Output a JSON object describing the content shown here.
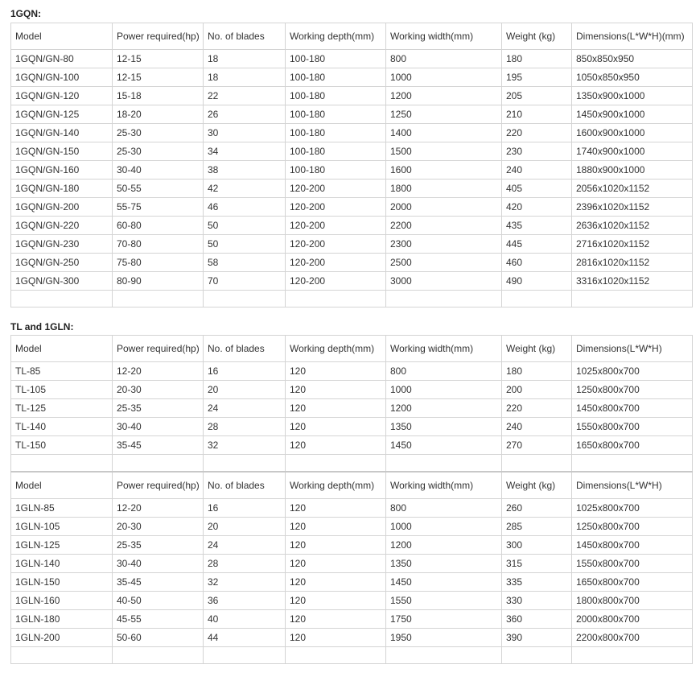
{
  "columns": [
    "Model",
    "Power required(hp)",
    "No. of blades",
    "Working depth(mm)",
    "Working width(mm)",
    "Weight (kg)"
  ],
  "section1": {
    "title": "1GQN:",
    "dim_header": "Dimensions(L*W*H)(mm)",
    "rows": [
      [
        "1GQN/GN-80",
        "12-15",
        "18",
        "100-180",
        "800",
        "180",
        "850x850x950"
      ],
      [
        "1GQN/GN-100",
        "12-15",
        "18",
        "100-180",
        "1000",
        "195",
        "1050x850x950"
      ],
      [
        "1GQN/GN-120",
        "15-18",
        "22",
        "100-180",
        "1200",
        "205",
        "1350x900x1000"
      ],
      [
        "1GQN/GN-125",
        "18-20",
        "26",
        "100-180",
        "1250",
        "210",
        "1450x900x1000"
      ],
      [
        "1GQN/GN-140",
        "25-30",
        "30",
        "100-180",
        "1400",
        "220",
        "1600x900x1000"
      ],
      [
        "1GQN/GN-150",
        "25-30",
        "34",
        "100-180",
        "1500",
        "230",
        "1740x900x1000"
      ],
      [
        "1GQN/GN-160",
        "30-40",
        "38",
        "100-180",
        "1600",
        "240",
        "1880x900x1000"
      ],
      [
        "1GQN/GN-180",
        "50-55",
        "42",
        "120-200",
        "1800",
        "405",
        "2056x1020x1152"
      ],
      [
        "1GQN/GN-200",
        "55-75",
        "46",
        "120-200",
        "2000",
        "420",
        "2396x1020x1152"
      ],
      [
        "1GQN/GN-220",
        "60-80",
        "50",
        "120-200",
        "2200",
        "435",
        "2636x1020x1152"
      ],
      [
        "1GQN/GN-230",
        "70-80",
        "50",
        "120-200",
        "2300",
        "445",
        "2716x1020x1152"
      ],
      [
        "1GQN/GN-250",
        "75-80",
        "58",
        "120-200",
        "2500",
        "460",
        "2816x1020x1152"
      ],
      [
        "1GQN/GN-300",
        "80-90",
        "70",
        "120-200",
        "3000",
        "490",
        "3316x1020x1152"
      ]
    ]
  },
  "section2": {
    "title": "TL and 1GLN:",
    "dim_header": "Dimensions(L*W*H)",
    "tl_rows": [
      [
        "TL-85",
        "12-20",
        "16",
        "120",
        "800",
        "180",
        "1025x800x700"
      ],
      [
        "TL-105",
        "20-30",
        "20",
        "120",
        "1000",
        "200",
        "1250x800x700"
      ],
      [
        "TL-125",
        "25-35",
        "24",
        "120",
        "1200",
        "220",
        "1450x800x700"
      ],
      [
        "TL-140",
        "30-40",
        "28",
        "120",
        "1350",
        "240",
        "1550x800x700"
      ],
      [
        "TL-150",
        "35-45",
        "32",
        "120",
        "1450",
        "270",
        "1650x800x700"
      ]
    ],
    "gln_rows": [
      [
        "1GLN-85",
        "12-20",
        "16",
        "120",
        "800",
        "260",
        "1025x800x700"
      ],
      [
        "1GLN-105",
        "20-30",
        "20",
        "120",
        "1000",
        "285",
        "1250x800x700"
      ],
      [
        "1GLN-125",
        "25-35",
        "24",
        "120",
        "1200",
        "300",
        "1450x800x700"
      ],
      [
        "1GLN-140",
        "30-40",
        "28",
        "120",
        "1350",
        "315",
        "1550x800x700"
      ],
      [
        "1GLN-150",
        "35-45",
        "32",
        "120",
        "1450",
        "335",
        "1650x800x700"
      ],
      [
        "1GLN-160",
        "40-50",
        "36",
        "120",
        "1550",
        "330",
        "1800x800x700"
      ],
      [
        "1GLN-180",
        "45-55",
        "40",
        "120",
        "1750",
        "360",
        "2000x800x700"
      ],
      [
        "1GLN-200",
        "50-60",
        "44",
        "120",
        "1950",
        "390",
        "2200x800x700"
      ]
    ]
  }
}
